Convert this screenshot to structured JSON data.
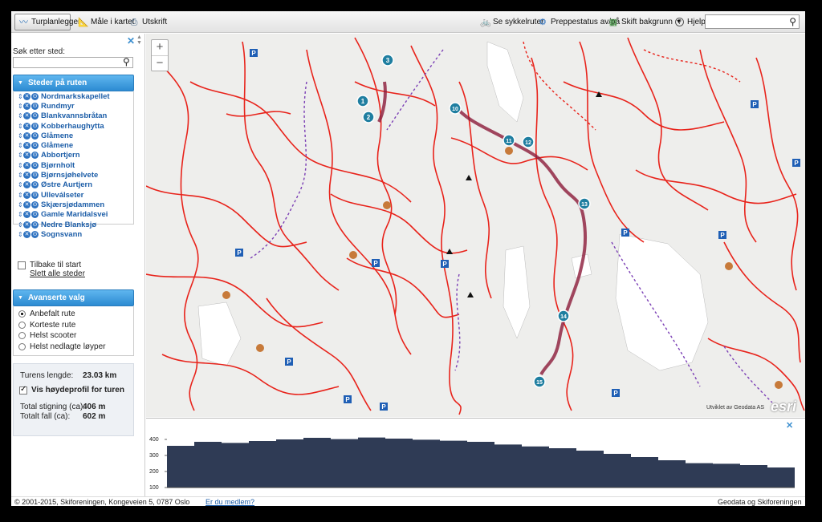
{
  "toolbar": {
    "route_planner": "Turplanlegger",
    "measure": "Måle i kartet",
    "print": "Utskrift",
    "bike_routes": "Se sykkelruter",
    "grooming_status": "Preppestatus av/på",
    "change_background": "Skift bakgrunn",
    "help": "Hjelp",
    "search_value": ""
  },
  "sidebar": {
    "search_label": "Søk etter sted:",
    "search_value": "",
    "stops_title": "Steder på ruten",
    "stops": [
      {
        "name": "Nordmarkskapellet"
      },
      {
        "name": "Rundmyr"
      },
      {
        "name": "Blankvannsbråtan"
      },
      {
        "name": "Kobberhaughytta"
      },
      {
        "name": "Glåmene"
      },
      {
        "name": "Glåmene"
      },
      {
        "name": "Abbortjern"
      },
      {
        "name": "Bjørnholt"
      },
      {
        "name": "Bjørnsjøhelvete"
      },
      {
        "name": "Østre Aurtjern"
      },
      {
        "name": "Ulleválseter"
      },
      {
        "name": "Skjærsjødammen"
      },
      {
        "name": "Gamle Maridalsvei"
      },
      {
        "name": "Nedre Blanksjø"
      },
      {
        "name": "Sognsvann"
      }
    ],
    "return_to_start": "Tilbake til start",
    "return_checked": false,
    "clear_all": "Slett alle steder",
    "advanced_title": "Avanserte valg",
    "options": [
      {
        "label": "Anbefalt rute",
        "selected": true
      },
      {
        "label": "Korteste rute",
        "selected": false
      },
      {
        "label": "Helst scooter",
        "selected": false
      },
      {
        "label": "Helst nedlagte løyper",
        "selected": false
      }
    ],
    "info": {
      "length_label": "Turens lengde:",
      "length_value": "23.03 km",
      "profile_label": "Vis høydeprofil for turen",
      "profile_checked": true,
      "ascent_label": "Total stigning (ca):",
      "ascent_value": "406 m",
      "descent_label": "Totalt fall (ca):",
      "descent_value": "602 m"
    }
  },
  "map": {
    "zoom_in": "+",
    "zoom_out": "−",
    "logo": "esri",
    "credit": "Utviklet av Geodata AS",
    "route_waypoints": [
      "1",
      "2",
      "3",
      "10",
      "11",
      "12",
      "13",
      "14",
      "15"
    ],
    "colors": {
      "trail": "#e8231b",
      "route": "#8b1a3a",
      "dashed": "#7b3fb5",
      "water": "#ffffff",
      "land": "#eeeeec"
    }
  },
  "chart_data": {
    "type": "area",
    "title": "",
    "xlabel": "",
    "ylabel": "",
    "ylim": [
      100,
      450
    ],
    "yticks": [
      400,
      300,
      200,
      100
    ],
    "x": [
      0,
      1,
      2,
      3,
      4,
      5,
      6,
      7,
      8,
      9,
      10,
      11,
      12,
      13,
      14,
      15,
      16,
      17,
      18,
      19,
      20,
      21,
      22,
      23
    ],
    "series": [
      {
        "values": [
          360,
          385,
          378,
          390,
          400,
          410,
          402,
          412,
          405,
          398,
          392,
          385,
          368,
          356,
          345,
          330,
          310,
          290,
          270,
          252,
          248,
          240,
          225,
          195
        ]
      }
    ],
    "color": "#2f3b55"
  },
  "footer": {
    "copyright": "© 2001-2015, Skiforeningen, Kongeveien 5, 0787 Oslo",
    "member": "Er du medlem?",
    "credits": "Geodata og Skiforeningen"
  }
}
